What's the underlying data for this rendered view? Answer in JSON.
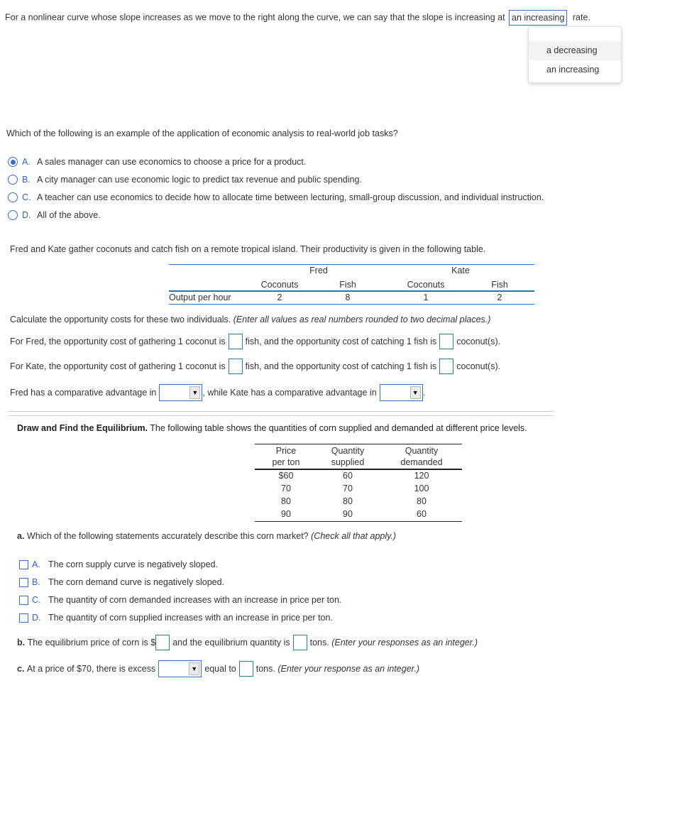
{
  "q1": {
    "text_before": "For a nonlinear curve whose slope increases as we move to the right along the curve, we can say that the slope is increasing at",
    "selected_value": "an increasing",
    "text_after": "rate.",
    "dropdown_options": [
      "a decreasing",
      "an increasing"
    ],
    "hovered_option": "a decreasing"
  },
  "q2": {
    "question": "Which of the following is an example of the application of economic analysis to real-world job tasks?",
    "selected": "A",
    "options": [
      {
        "letter": "A.",
        "text": "A sales manager can use economics to choose a price for a product."
      },
      {
        "letter": "B.",
        "text": "A city manager can use economic logic to predict tax revenue and public spending."
      },
      {
        "letter": "C.",
        "text": "A teacher can use economics to decide how to allocate time between lecturing, small-group discussion, and individual instruction."
      },
      {
        "letter": "D.",
        "text": "All of the above."
      }
    ]
  },
  "q3": {
    "intro": "Fred and Kate gather coconuts and catch fish on a remote tropical island. Their productivity is given in the following table.",
    "table": {
      "groups": [
        "Fred",
        "Kate"
      ],
      "subheaders": [
        "Coconuts",
        "Fish",
        "Coconuts",
        "Fish"
      ],
      "row_label": "Output per hour",
      "values": [
        "2",
        "8",
        "1",
        "2"
      ]
    },
    "calc_prompt": "Calculate the opportunity costs for these two individuals.",
    "calc_instruction": "(Enter all values as real numbers rounded to two decimal places.)",
    "fred_line": {
      "part1": "For Fred, the opportunity cost of gathering 1 coconut is",
      "part2": "fish, and the opportunity cost of catching 1 fish is",
      "part3": "coconut(s).",
      "value1": "",
      "value2": ""
    },
    "kate_line": {
      "part1": "For Kate, the opportunity cost of gathering 1 coconut is",
      "part2": "fish, and the opportunity cost of catching 1 fish is",
      "part3": "coconut(s).",
      "value1": "",
      "value2": ""
    },
    "advantage_line": {
      "part1": "Fred has a comparative advantage in",
      "part2": ", while Kate has a comparative advantage in",
      "part3": ".",
      "fred_selected": "",
      "kate_selected": ""
    }
  },
  "q4": {
    "title_bold": "Draw and Find the Equilibrium.",
    "title_rest": "The following table shows the quantities of corn supplied and demanded at different price levels.",
    "table": {
      "headers": [
        [
          "Price",
          "per ton"
        ],
        [
          "Quantity",
          "supplied"
        ],
        [
          "Quantity",
          "demanded"
        ]
      ],
      "rows": [
        [
          "$60",
          "60",
          "120"
        ],
        [
          "70",
          "70",
          "100"
        ],
        [
          "80",
          "80",
          "80"
        ],
        [
          "90",
          "90",
          "60"
        ]
      ]
    },
    "part_a": {
      "label": "a.",
      "question": "Which of the following statements accurately describe this corn market?",
      "instruction": "(Check all that apply.)",
      "options": [
        {
          "letter": "A.",
          "text": "The corn supply curve is negatively sloped.",
          "checked": false
        },
        {
          "letter": "B.",
          "text": "The corn demand curve is negatively sloped.",
          "checked": false
        },
        {
          "letter": "C.",
          "text": "The quantity of corn demanded increases with an increase in price per ton.",
          "checked": false
        },
        {
          "letter": "D.",
          "text": "The quantity of corn supplied increases with an increase in price per ton.",
          "checked": false
        }
      ]
    },
    "part_b": {
      "label": "b.",
      "text1": "The equilibrium price of corn is $",
      "text2": "and the equilibrium quantity is",
      "text3": "tons.",
      "instruction": "(Enter your responses as an integer.)",
      "price_value": "",
      "quantity_value": ""
    },
    "part_c": {
      "label": "c.",
      "text1": "At a price of $70, there is excess",
      "text2": "equal to",
      "text3": "tons.",
      "instruction": "(Enter your response as an integer.)",
      "excess_selected": "",
      "amount_value": ""
    }
  }
}
